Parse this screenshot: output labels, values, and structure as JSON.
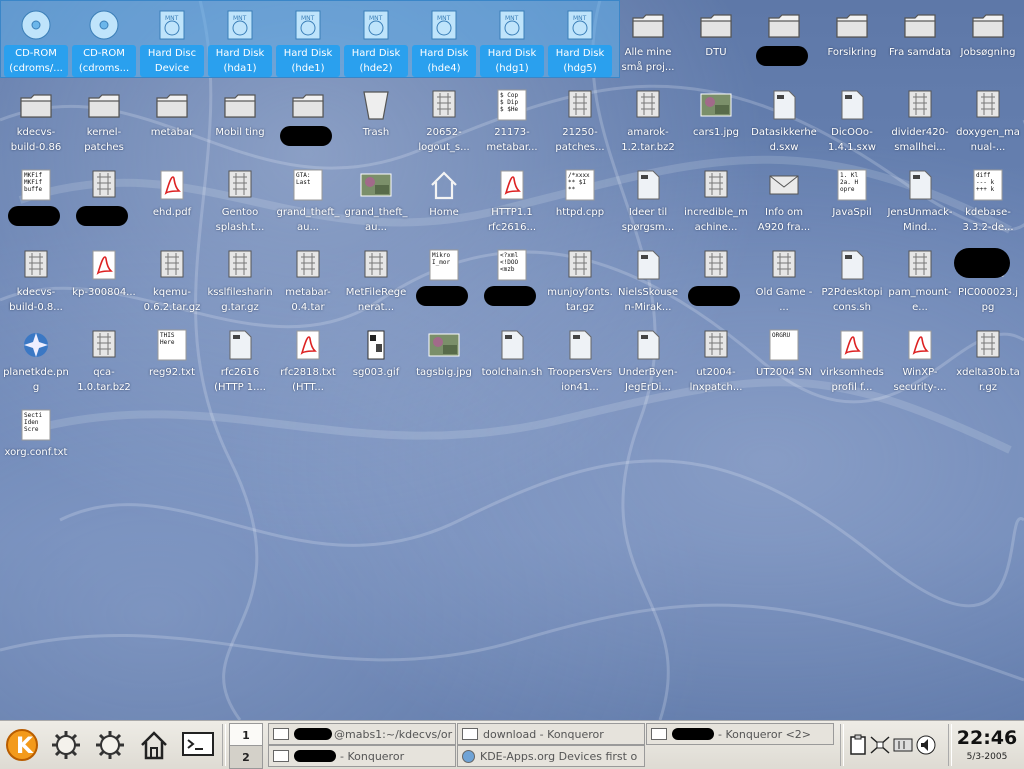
{
  "desktop": {
    "icons": [
      {
        "label": "CD-ROM (cdroms/...",
        "type": "cdrom",
        "sel": true
      },
      {
        "label": "CD-ROM (cdroms...",
        "type": "cdrom",
        "sel": true
      },
      {
        "label": "Hard Disc Device",
        "type": "hdd",
        "sel": true
      },
      {
        "label": "Hard Disk (hda1)",
        "type": "hdd",
        "sel": true
      },
      {
        "label": "Hard Disk (hde1)",
        "type": "hdd",
        "sel": true
      },
      {
        "label": "Hard Disk (hde2)",
        "type": "hdd",
        "sel": true
      },
      {
        "label": "Hard Disk (hde4)",
        "type": "hdd",
        "sel": true
      },
      {
        "label": "Hard Disk (hdg1)",
        "type": "hdd",
        "sel": true
      },
      {
        "label": "Hard Disk (hdg5)",
        "type": "hdd",
        "sel": true
      },
      {
        "label": "Alle mine små proj...",
        "type": "folder"
      },
      {
        "label": "DTU",
        "type": "folder"
      },
      {
        "label": "",
        "type": "folder",
        "redacted": true
      },
      {
        "label": "Forsikring",
        "type": "folder"
      },
      {
        "label": "Fra samdata",
        "type": "folder"
      },
      {
        "label": "Jobsøgning",
        "type": "folder"
      },
      {
        "label": "kdecvs-build-0.86",
        "type": "folder"
      },
      {
        "label": "kernel-patches",
        "type": "folder"
      },
      {
        "label": "metabar",
        "type": "folder"
      },
      {
        "label": "Mobil ting",
        "type": "folder"
      },
      {
        "label": "",
        "type": "folder",
        "redacted": true
      },
      {
        "label": "Trash",
        "type": "trash"
      },
      {
        "label": "20652-logout_s...",
        "type": "archive"
      },
      {
        "label": "21173-metabar...",
        "type": "text",
        "preview": "$ Cop\n$ Dip\n$ $He"
      },
      {
        "label": "21250-patches...",
        "type": "archive"
      },
      {
        "label": "amarok-1.2.tar.bz2",
        "type": "archive"
      },
      {
        "label": "cars1.jpg",
        "type": "image"
      },
      {
        "label": "Datasikkerhed.sxw",
        "type": "doc"
      },
      {
        "label": "DicOOo-1.4.1.sxw",
        "type": "doc"
      },
      {
        "label": "divider420-smallhei...",
        "type": "archive"
      },
      {
        "label": "doxygen_manual-...",
        "type": "archive"
      },
      {
        "label": "",
        "type": "text",
        "preview": "MKFif\nMKFif\nbuffe",
        "redacted": true
      },
      {
        "label": "",
        "type": "archive",
        "redacted": true
      },
      {
        "label": "ehd.pdf",
        "type": "pdf"
      },
      {
        "label": "Gentoo splash.t...",
        "type": "archive"
      },
      {
        "label": "grand_theft_au...",
        "type": "text",
        "preview": "GTA:\nLast"
      },
      {
        "label": "grand_theft_au...",
        "type": "image"
      },
      {
        "label": "Home",
        "type": "home"
      },
      {
        "label": "HTTP1.1 rfc2616...",
        "type": "pdf"
      },
      {
        "label": "httpd.cpp",
        "type": "text",
        "preview": "/*xxxx\n** $I\n**"
      },
      {
        "label": "Ideer til spørgsm...",
        "type": "doc"
      },
      {
        "label": "incredible_machine...",
        "type": "archive"
      },
      {
        "label": "Info om A920 fra...",
        "type": "mail"
      },
      {
        "label": "JavaSpil",
        "type": "text",
        "preview": "1. Kl\n2a. H\nopre"
      },
      {
        "label": "JensUnmack-Mind...",
        "type": "doc"
      },
      {
        "label": "kdebase-3.3.2-de...",
        "type": "text",
        "preview": "diff\n--- k\n+++ k"
      },
      {
        "label": "kdecvs-build-0.8...",
        "type": "archive"
      },
      {
        "label": "kp-300804...",
        "type": "pdf"
      },
      {
        "label": "kqemu-0.6.2.tar.gz",
        "type": "archive"
      },
      {
        "label": "ksslfilesharing.tar.gz",
        "type": "archive"
      },
      {
        "label": "metabar-0.4.tar",
        "type": "archive"
      },
      {
        "label": "MetFileRegenerat...",
        "type": "archive"
      },
      {
        "label": "",
        "type": "text",
        "preview": "Mikro\nI_mor",
        "redacted": true
      },
      {
        "label": "",
        "type": "text",
        "preview": "<?xml\n<!DOO\n<mzb",
        "redacted": true
      },
      {
        "label": "munjoyfonts.tar.gz",
        "type": "archive"
      },
      {
        "label": "NielsSkousen-Mirak...",
        "type": "doc"
      },
      {
        "label": "",
        "type": "archive",
        "redacted": true
      },
      {
        "label": "Old Game - ...",
        "type": "archive"
      },
      {
        "label": "P2Pdesktopicons.sh",
        "type": "script"
      },
      {
        "label": "pam_mount-e...",
        "type": "archive"
      },
      {
        "label": "PIC000023.jpg",
        "type": "image",
        "redactedIcon": true
      },
      {
        "label": "planetkde.png",
        "type": "png"
      },
      {
        "label": "qca-1.0.tar.bz2",
        "type": "archive"
      },
      {
        "label": "reg92.txt",
        "type": "text",
        "preview": "THIS\nHere"
      },
      {
        "label": "rfc2616 (HTTP 1....",
        "type": "doc"
      },
      {
        "label": "rfc2818.txt (HTT...",
        "type": "pdf"
      },
      {
        "label": "sg003.gif",
        "type": "image2"
      },
      {
        "label": "tagsbig.jpg",
        "type": "image"
      },
      {
        "label": "toolchain.sh",
        "type": "script"
      },
      {
        "label": "TroopersVersion41...",
        "type": "doc"
      },
      {
        "label": "UnderByen-JegErDi...",
        "type": "doc"
      },
      {
        "label": "ut2004-lnxpatch...",
        "type": "archive"
      },
      {
        "label": "UT2004 SN",
        "type": "text",
        "preview": "ORGRU"
      },
      {
        "label": "virksomhedsprofil f...",
        "type": "pdf"
      },
      {
        "label": "WinXP-security-...",
        "type": "pdf"
      },
      {
        "label": "xdelta30b.tar.gz",
        "type": "archive"
      },
      {
        "label": "xorg.conf.txt",
        "type": "text",
        "preview": "Secti\nIden\nScre"
      }
    ]
  },
  "panel": {
    "launchers": [
      {
        "name": "kde-menu-icon"
      },
      {
        "name": "gear-icon"
      },
      {
        "name": "gear-icon-2"
      },
      {
        "name": "home-icon"
      },
      {
        "name": "terminal-icon"
      }
    ],
    "pager": [
      "1",
      "2"
    ],
    "tasks": [
      {
        "label": "@mabs1:~/kdecvs/or",
        "redacted": true
      },
      {
        "label": "download - Konqueror"
      },
      {
        "label": "- Konqueror <2>",
        "redacted": true
      },
      {
        "label": "- Konqueror",
        "redacted": true
      },
      {
        "label": "KDE-Apps.org Devices first o"
      }
    ],
    "clock": {
      "time": "22:46",
      "date": "5/3-2005"
    }
  }
}
